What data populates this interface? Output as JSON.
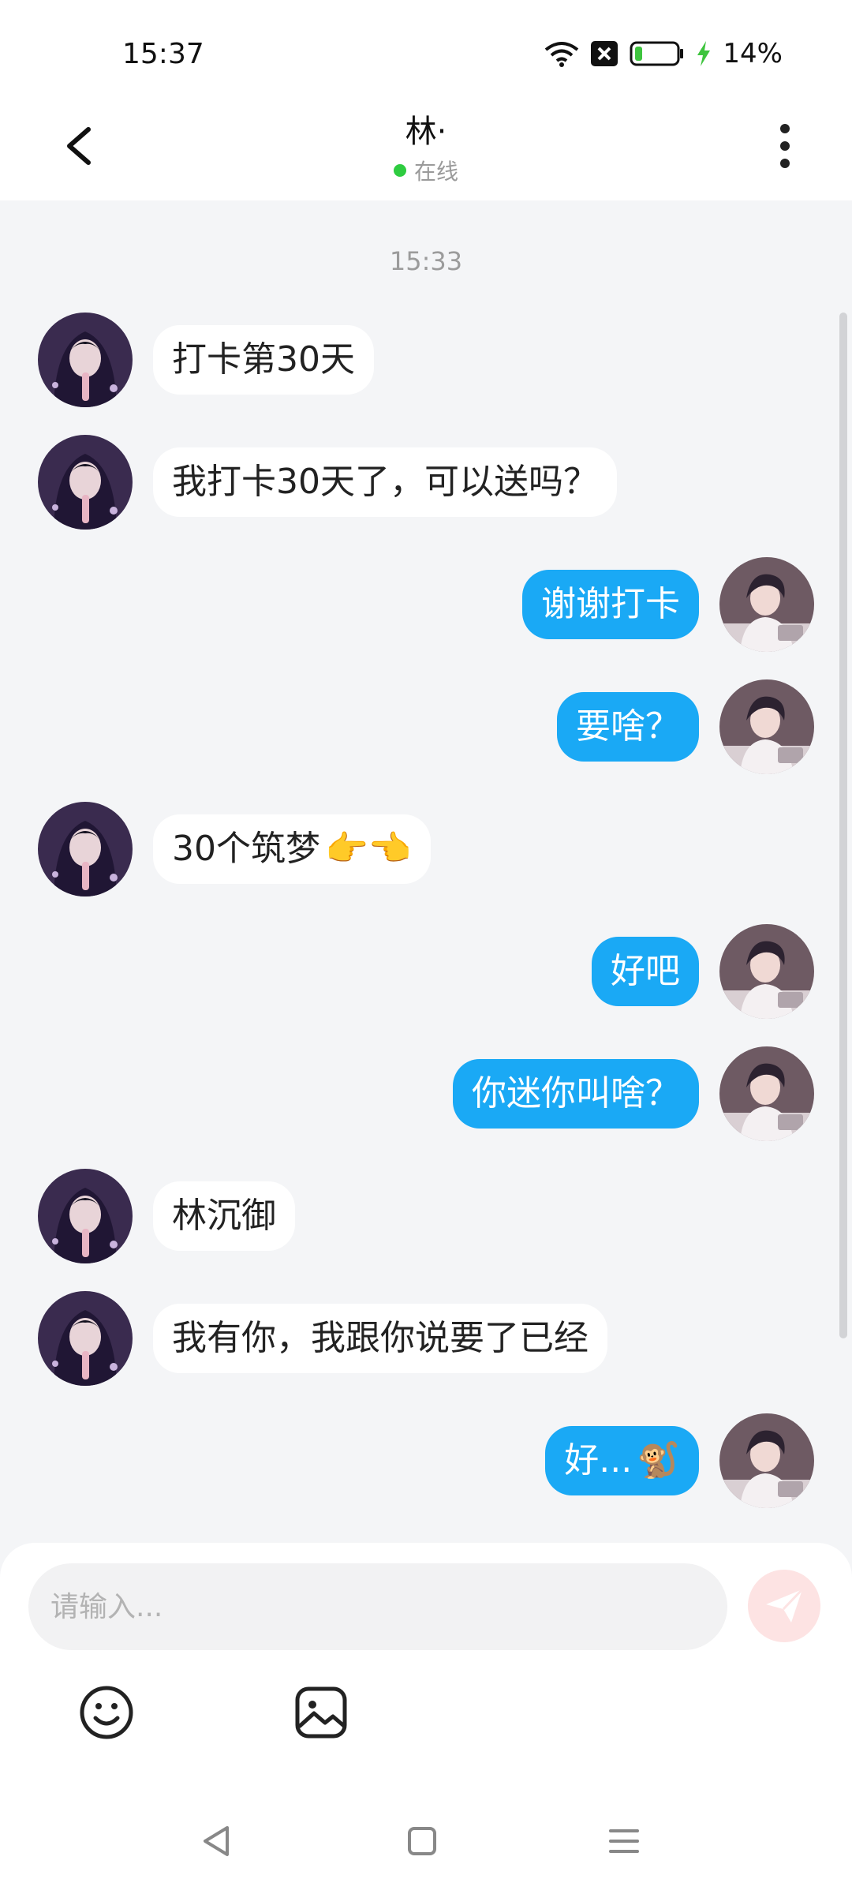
{
  "status_bar": {
    "time": "15:37",
    "battery": "14%"
  },
  "header": {
    "title": "林·",
    "status": "在线"
  },
  "chat": {
    "timestamp": "15:33",
    "messages": [
      {
        "side": "left",
        "text": "打卡第30天",
        "emoji": ""
      },
      {
        "side": "left",
        "text": "我打卡30天了，可以送吗？",
        "emoji": ""
      },
      {
        "side": "right",
        "text": "谢谢打卡",
        "emoji": ""
      },
      {
        "side": "right",
        "text": "要啥？",
        "emoji": ""
      },
      {
        "side": "left",
        "text": "30个筑梦",
        "emoji": "👉👈"
      },
      {
        "side": "right",
        "text": "好吧",
        "emoji": ""
      },
      {
        "side": "right",
        "text": "你迷你叫啥？",
        "emoji": ""
      },
      {
        "side": "left",
        "text": "林沉御",
        "emoji": ""
      },
      {
        "side": "left",
        "text": "我有你，我跟你说要了已经",
        "emoji": ""
      },
      {
        "side": "right",
        "text": "好...",
        "emoji": "🐒"
      }
    ]
  },
  "input": {
    "placeholder": "请输入..."
  },
  "colors": {
    "accent": "#1aa9f5",
    "online": "#2ecc40",
    "send_disabled": "#fde3e3"
  }
}
